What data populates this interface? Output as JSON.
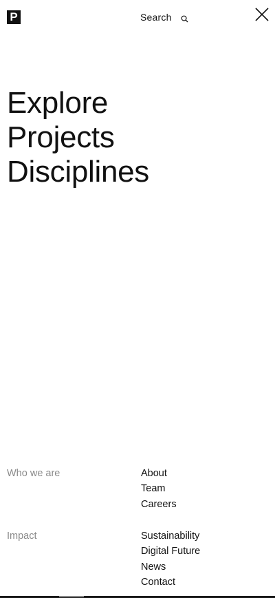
{
  "header": {
    "logo_letter": "P",
    "search_label": "Search"
  },
  "main_nav": {
    "items": [
      {
        "label": "Explore"
      },
      {
        "label": "Projects"
      },
      {
        "label": "Disciplines"
      }
    ]
  },
  "sections": [
    {
      "title": "Who we are",
      "links": [
        {
          "label": "About"
        },
        {
          "label": "Team"
        },
        {
          "label": "Careers"
        }
      ]
    },
    {
      "title": "Impact",
      "links": [
        {
          "label": "Sustainability"
        },
        {
          "label": "Digital Future"
        },
        {
          "label": "News"
        },
        {
          "label": "Contact"
        }
      ]
    }
  ],
  "colors": {
    "text": "#111111",
    "muted": "#8a8a8a",
    "background": "#ffffff"
  },
  "icons": {
    "search": "search-icon",
    "close": "close-icon"
  }
}
